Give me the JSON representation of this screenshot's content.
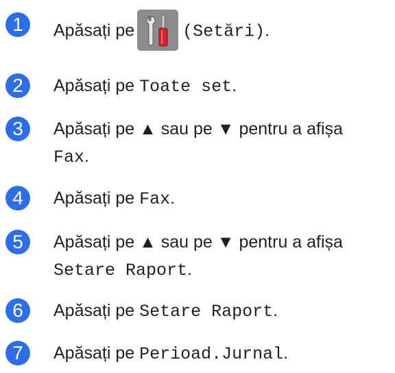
{
  "colors": {
    "step_badge": "#2d6ee6",
    "text": "#231f20",
    "settings_button_bg": "#8a8c8e"
  },
  "steps": [
    {
      "number": "1",
      "text": "Apăsați pe",
      "icon": "settings-tools-icon",
      "mono": "(Setări)",
      "end": "."
    },
    {
      "number": "2",
      "text": "Apăsați pe",
      "mono": "Toate set",
      "end": "."
    },
    {
      "number": "3",
      "text": "Apăsați pe ▲ sau pe ▼ pentru a afișa",
      "mono": "Fax",
      "end": "."
    },
    {
      "number": "4",
      "text": "Apăsați pe",
      "mono": "Fax",
      "end": "."
    },
    {
      "number": "5",
      "text": "Apăsați pe ▲ sau pe ▼ pentru a afișa",
      "mono": "Setare Raport",
      "end": "."
    },
    {
      "number": "6",
      "text": "Apăsați pe",
      "mono": "Setare Raport",
      "end": "."
    },
    {
      "number": "7",
      "text": "Apăsați pe",
      "mono": "Perioad.Jurnal",
      "end": "."
    }
  ]
}
